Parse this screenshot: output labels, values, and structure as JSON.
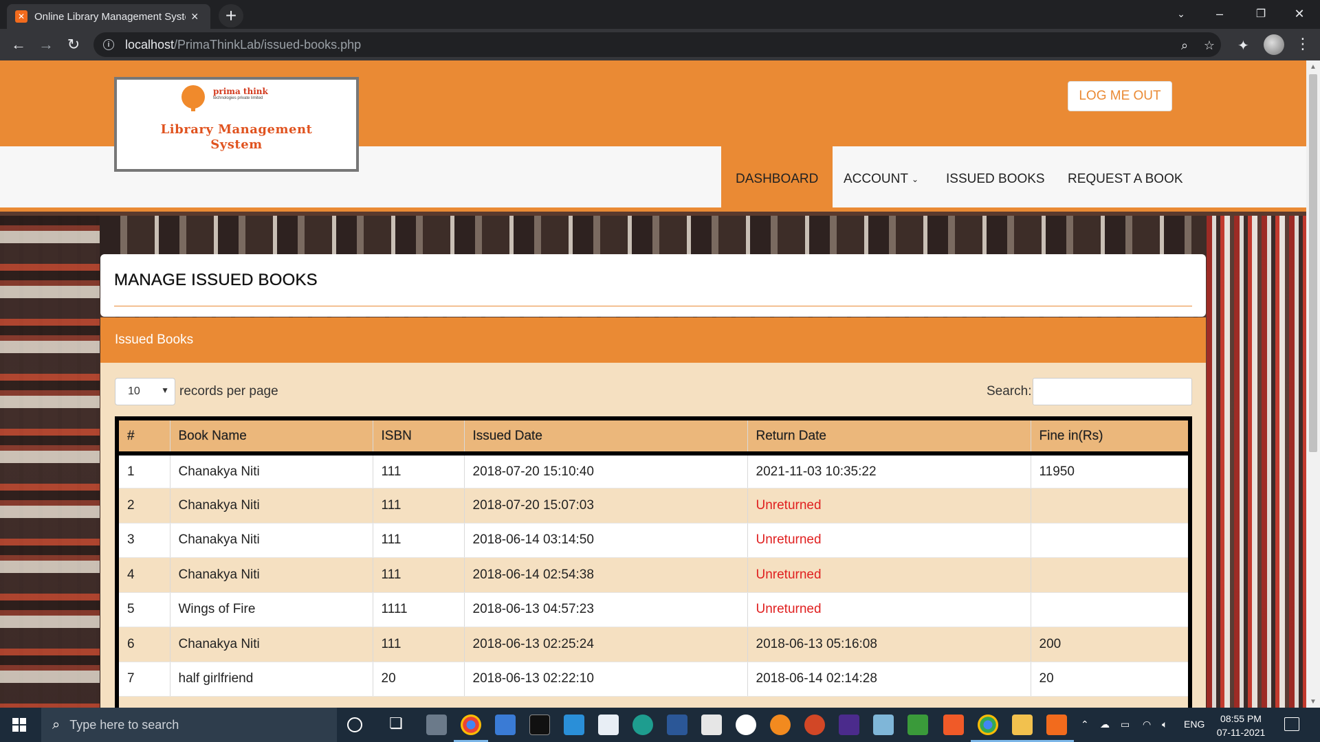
{
  "browser": {
    "tab_title": "Online Library Management System",
    "tab_close": "×",
    "new_tab": "+",
    "url_host": "localhost",
    "url_path": "/PrimaThinkLab/issued-books.php"
  },
  "header": {
    "logo_brand": "prima think",
    "logo_sub": "technologies private limited",
    "logo_title_line1": "Library Management",
    "logo_title_line2": "System",
    "logout_label": "LOG ME OUT"
  },
  "menu": {
    "items": [
      {
        "label": "DASHBOARD"
      },
      {
        "label": "ACCOUNT"
      },
      {
        "label": "ISSUED BOOKS"
      },
      {
        "label": "REQUEST A BOOK"
      }
    ]
  },
  "page": {
    "title": "MANAGE ISSUED BOOKS",
    "panel_title": "Issued Books",
    "page_length": "10",
    "length_label": "records per page",
    "search_label": "Search:"
  },
  "table": {
    "headers": [
      "#",
      "Book Name",
      "ISBN",
      "Issued Date",
      "Return Date",
      "Fine in(Rs)"
    ],
    "rows": [
      {
        "n": "1",
        "book": "Chanakya Niti",
        "isbn": "111",
        "issued": "2018-07-20 15:10:40",
        "ret": "2021-11-03 10:35:22",
        "fine": "11950",
        "unreturned": false
      },
      {
        "n": "2",
        "book": "Chanakya Niti",
        "isbn": "111",
        "issued": "2018-07-20 15:07:03",
        "ret": "Unreturned",
        "fine": "",
        "unreturned": true
      },
      {
        "n": "3",
        "book": "Chanakya Niti",
        "isbn": "111",
        "issued": "2018-06-14 03:14:50",
        "ret": "Unreturned",
        "fine": "",
        "unreturned": true
      },
      {
        "n": "4",
        "book": "Chanakya Niti",
        "isbn": "111",
        "issued": "2018-06-14 02:54:38",
        "ret": "Unreturned",
        "fine": "",
        "unreturned": true
      },
      {
        "n": "5",
        "book": "Wings of Fire",
        "isbn": "1111",
        "issued": "2018-06-13 04:57:23",
        "ret": "Unreturned",
        "fine": "",
        "unreturned": true
      },
      {
        "n": "6",
        "book": "Chanakya Niti",
        "isbn": "111",
        "issued": "2018-06-13 02:25:24",
        "ret": "2018-06-13 05:16:08",
        "fine": "200",
        "unreturned": false
      },
      {
        "n": "7",
        "book": "half girlfriend",
        "isbn": "20",
        "issued": "2018-06-13 02:22:10",
        "ret": "2018-06-14 02:14:28",
        "fine": "20",
        "unreturned": false
      }
    ]
  },
  "taskbar": {
    "search_placeholder": "Type here to search",
    "lang": "ENG",
    "time": "08:55 PM",
    "date": "07-11-2021"
  },
  "colors": {
    "accent": "#ea8a34",
    "unreturned": "#e02020",
    "row_alt": "#f5e0c1",
    "header_row": "#ebb77b"
  }
}
